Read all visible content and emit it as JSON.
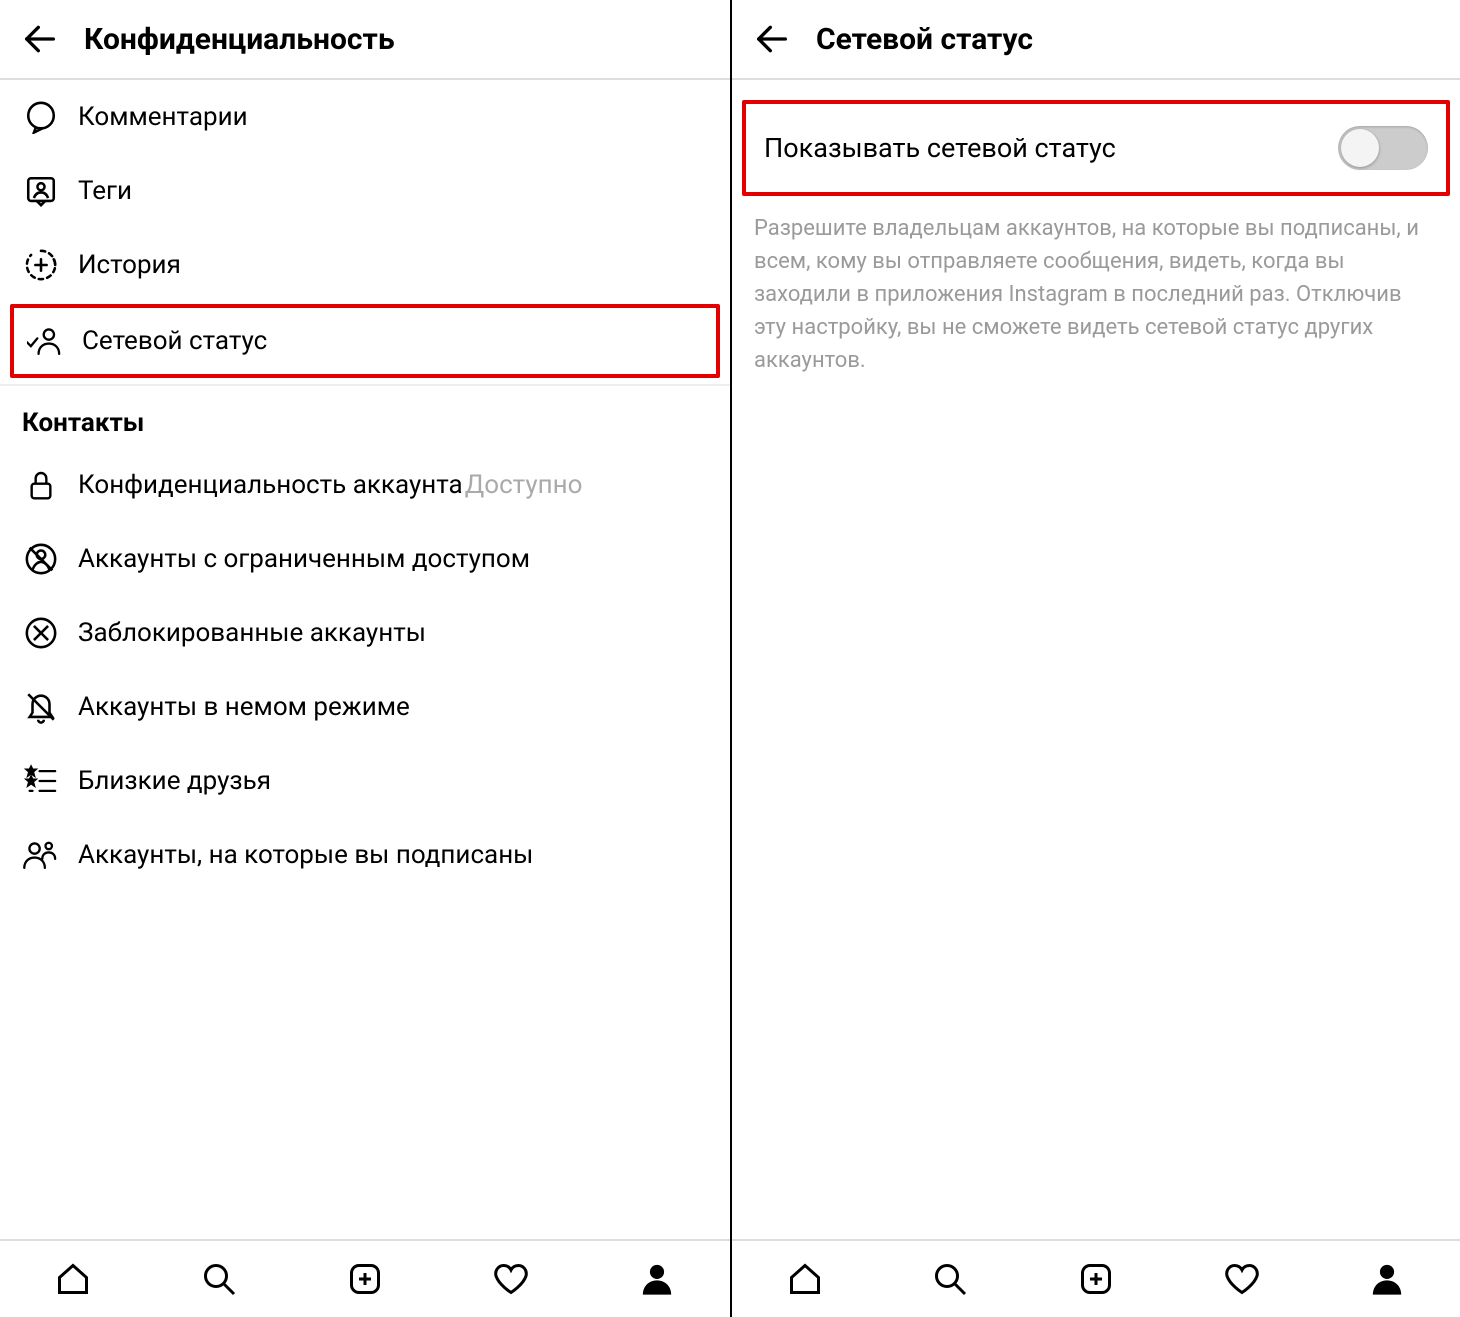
{
  "left": {
    "header_title": "Конфиденциальность",
    "items": [
      {
        "label": "Комментарии"
      },
      {
        "label": "Теги"
      },
      {
        "label": "История"
      },
      {
        "label": "Сетевой статус"
      }
    ],
    "contacts_section_title": "Контакты",
    "contacts": [
      {
        "label": "Конфиденциальность аккаунта",
        "extra": "Доступно"
      },
      {
        "label": "Аккаунты с ограниченным доступом"
      },
      {
        "label": "Заблокированные аккаунты"
      },
      {
        "label": "Аккаунты в немом режиме"
      },
      {
        "label": "Близкие друзья"
      },
      {
        "label": "Аккаунты, на которые вы подписаны"
      }
    ]
  },
  "right": {
    "header_title": "Сетевой статус",
    "toggle_label": "Показывать сетевой статус",
    "toggle_on": false,
    "description": "Разрешите владельцам аккаунтов, на которые вы подписаны, и всем, кому вы отправляете сообщения, видеть, когда вы заходили в приложения Instagram в последний раз. Отключив эту настройку, вы не сможете видеть сетевой статус других аккаунтов."
  }
}
